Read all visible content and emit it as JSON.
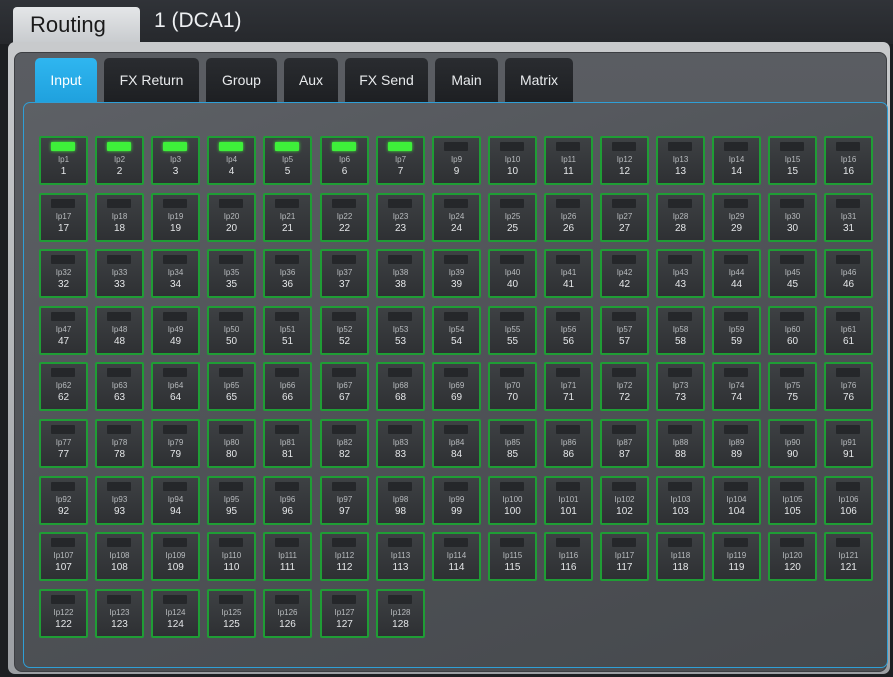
{
  "header": {
    "title": "Routing",
    "subtitle": "1 (DCA1)"
  },
  "tabs": [
    {
      "label": "Input",
      "active": true
    },
    {
      "label": "FX Return",
      "active": false
    },
    {
      "label": "Group",
      "active": false
    },
    {
      "label": "Aux",
      "active": false
    },
    {
      "label": "FX Send",
      "active": false
    },
    {
      "label": "Main",
      "active": false
    },
    {
      "label": "Matrix",
      "active": false
    }
  ],
  "colors": {
    "accent": "#2fb6f0",
    "led_on": "#3ef03a",
    "button_border": "#1f9d35"
  },
  "inputs": [
    {
      "name": "Ip1",
      "number": "1",
      "on": true
    },
    {
      "name": "Ip2",
      "number": "2",
      "on": true
    },
    {
      "name": "Ip3",
      "number": "3",
      "on": true
    },
    {
      "name": "Ip4",
      "number": "4",
      "on": true
    },
    {
      "name": "Ip5",
      "number": "5",
      "on": true
    },
    {
      "name": "Ip6",
      "number": "6",
      "on": true
    },
    {
      "name": "Ip7",
      "number": "7",
      "on": true
    },
    {
      "name": "Ip9",
      "number": "9",
      "on": false
    },
    {
      "name": "Ip10",
      "number": "10",
      "on": false
    },
    {
      "name": "Ip11",
      "number": "11",
      "on": false
    },
    {
      "name": "Ip12",
      "number": "12",
      "on": false
    },
    {
      "name": "Ip13",
      "number": "13",
      "on": false
    },
    {
      "name": "Ip14",
      "number": "14",
      "on": false
    },
    {
      "name": "Ip15",
      "number": "15",
      "on": false
    },
    {
      "name": "Ip16",
      "number": "16",
      "on": false
    },
    {
      "name": "Ip17",
      "number": "17",
      "on": false
    },
    {
      "name": "Ip18",
      "number": "18",
      "on": false
    },
    {
      "name": "Ip19",
      "number": "19",
      "on": false
    },
    {
      "name": "Ip20",
      "number": "20",
      "on": false
    },
    {
      "name": "Ip21",
      "number": "21",
      "on": false
    },
    {
      "name": "Ip22",
      "number": "22",
      "on": false
    },
    {
      "name": "Ip23",
      "number": "23",
      "on": false
    },
    {
      "name": "Ip24",
      "number": "24",
      "on": false
    },
    {
      "name": "Ip25",
      "number": "25",
      "on": false
    },
    {
      "name": "Ip26",
      "number": "26",
      "on": false
    },
    {
      "name": "Ip27",
      "number": "27",
      "on": false
    },
    {
      "name": "Ip28",
      "number": "28",
      "on": false
    },
    {
      "name": "Ip29",
      "number": "29",
      "on": false
    },
    {
      "name": "Ip30",
      "number": "30",
      "on": false
    },
    {
      "name": "Ip31",
      "number": "31",
      "on": false
    },
    {
      "name": "Ip32",
      "number": "32",
      "on": false
    },
    {
      "name": "Ip33",
      "number": "33",
      "on": false
    },
    {
      "name": "Ip34",
      "number": "34",
      "on": false
    },
    {
      "name": "Ip35",
      "number": "35",
      "on": false
    },
    {
      "name": "Ip36",
      "number": "36",
      "on": false
    },
    {
      "name": "Ip37",
      "number": "37",
      "on": false
    },
    {
      "name": "Ip38",
      "number": "38",
      "on": false
    },
    {
      "name": "Ip39",
      "number": "39",
      "on": false
    },
    {
      "name": "Ip40",
      "number": "40",
      "on": false
    },
    {
      "name": "Ip41",
      "number": "41",
      "on": false
    },
    {
      "name": "Ip42",
      "number": "42",
      "on": false
    },
    {
      "name": "Ip43",
      "number": "43",
      "on": false
    },
    {
      "name": "Ip44",
      "number": "44",
      "on": false
    },
    {
      "name": "Ip45",
      "number": "45",
      "on": false
    },
    {
      "name": "Ip46",
      "number": "46",
      "on": false
    },
    {
      "name": "Ip47",
      "number": "47",
      "on": false
    },
    {
      "name": "Ip48",
      "number": "48",
      "on": false
    },
    {
      "name": "Ip49",
      "number": "49",
      "on": false
    },
    {
      "name": "Ip50",
      "number": "50",
      "on": false
    },
    {
      "name": "Ip51",
      "number": "51",
      "on": false
    },
    {
      "name": "Ip52",
      "number": "52",
      "on": false
    },
    {
      "name": "Ip53",
      "number": "53",
      "on": false
    },
    {
      "name": "Ip54",
      "number": "54",
      "on": false
    },
    {
      "name": "Ip55",
      "number": "55",
      "on": false
    },
    {
      "name": "Ip56",
      "number": "56",
      "on": false
    },
    {
      "name": "Ip57",
      "number": "57",
      "on": false
    },
    {
      "name": "Ip58",
      "number": "58",
      "on": false
    },
    {
      "name": "Ip59",
      "number": "59",
      "on": false
    },
    {
      "name": "Ip60",
      "number": "60",
      "on": false
    },
    {
      "name": "Ip61",
      "number": "61",
      "on": false
    },
    {
      "name": "Ip62",
      "number": "62",
      "on": false
    },
    {
      "name": "Ip63",
      "number": "63",
      "on": false
    },
    {
      "name": "Ip64",
      "number": "64",
      "on": false
    },
    {
      "name": "Ip65",
      "number": "65",
      "on": false
    },
    {
      "name": "Ip66",
      "number": "66",
      "on": false
    },
    {
      "name": "Ip67",
      "number": "67",
      "on": false
    },
    {
      "name": "Ip68",
      "number": "68",
      "on": false
    },
    {
      "name": "Ip69",
      "number": "69",
      "on": false
    },
    {
      "name": "Ip70",
      "number": "70",
      "on": false
    },
    {
      "name": "Ip71",
      "number": "71",
      "on": false
    },
    {
      "name": "Ip72",
      "number": "72",
      "on": false
    },
    {
      "name": "Ip73",
      "number": "73",
      "on": false
    },
    {
      "name": "Ip74",
      "number": "74",
      "on": false
    },
    {
      "name": "Ip75",
      "number": "75",
      "on": false
    },
    {
      "name": "Ip76",
      "number": "76",
      "on": false
    },
    {
      "name": "Ip77",
      "number": "77",
      "on": false
    },
    {
      "name": "Ip78",
      "number": "78",
      "on": false
    },
    {
      "name": "Ip79",
      "number": "79",
      "on": false
    },
    {
      "name": "Ip80",
      "number": "80",
      "on": false
    },
    {
      "name": "Ip81",
      "number": "81",
      "on": false
    },
    {
      "name": "Ip82",
      "number": "82",
      "on": false
    },
    {
      "name": "Ip83",
      "number": "83",
      "on": false
    },
    {
      "name": "Ip84",
      "number": "84",
      "on": false
    },
    {
      "name": "Ip85",
      "number": "85",
      "on": false
    },
    {
      "name": "Ip86",
      "number": "86",
      "on": false
    },
    {
      "name": "Ip87",
      "number": "87",
      "on": false
    },
    {
      "name": "Ip88",
      "number": "88",
      "on": false
    },
    {
      "name": "Ip89",
      "number": "89",
      "on": false
    },
    {
      "name": "Ip90",
      "number": "90",
      "on": false
    },
    {
      "name": "Ip91",
      "number": "91",
      "on": false
    },
    {
      "name": "Ip92",
      "number": "92",
      "on": false
    },
    {
      "name": "Ip93",
      "number": "93",
      "on": false
    },
    {
      "name": "Ip94",
      "number": "94",
      "on": false
    },
    {
      "name": "Ip95",
      "number": "95",
      "on": false
    },
    {
      "name": "Ip96",
      "number": "96",
      "on": false
    },
    {
      "name": "Ip97",
      "number": "97",
      "on": false
    },
    {
      "name": "Ip98",
      "number": "98",
      "on": false
    },
    {
      "name": "Ip99",
      "number": "99",
      "on": false
    },
    {
      "name": "Ip100",
      "number": "100",
      "on": false
    },
    {
      "name": "Ip101",
      "number": "101",
      "on": false
    },
    {
      "name": "Ip102",
      "number": "102",
      "on": false
    },
    {
      "name": "Ip103",
      "number": "103",
      "on": false
    },
    {
      "name": "Ip104",
      "number": "104",
      "on": false
    },
    {
      "name": "Ip105",
      "number": "105",
      "on": false
    },
    {
      "name": "Ip106",
      "number": "106",
      "on": false
    },
    {
      "name": "Ip107",
      "number": "107",
      "on": false
    },
    {
      "name": "Ip108",
      "number": "108",
      "on": false
    },
    {
      "name": "Ip109",
      "number": "109",
      "on": false
    },
    {
      "name": "Ip110",
      "number": "110",
      "on": false
    },
    {
      "name": "Ip111",
      "number": "111",
      "on": false
    },
    {
      "name": "Ip112",
      "number": "112",
      "on": false
    },
    {
      "name": "Ip113",
      "number": "113",
      "on": false
    },
    {
      "name": "Ip114",
      "number": "114",
      "on": false
    },
    {
      "name": "Ip115",
      "number": "115",
      "on": false
    },
    {
      "name": "Ip116",
      "number": "116",
      "on": false
    },
    {
      "name": "Ip117",
      "number": "117",
      "on": false
    },
    {
      "name": "Ip118",
      "number": "118",
      "on": false
    },
    {
      "name": "Ip119",
      "number": "119",
      "on": false
    },
    {
      "name": "Ip120",
      "number": "120",
      "on": false
    },
    {
      "name": "Ip121",
      "number": "121",
      "on": false
    },
    {
      "name": "Ip122",
      "number": "122",
      "on": false
    },
    {
      "name": "Ip123",
      "number": "123",
      "on": false
    },
    {
      "name": "Ip124",
      "number": "124",
      "on": false
    },
    {
      "name": "Ip125",
      "number": "125",
      "on": false
    },
    {
      "name": "Ip126",
      "number": "126",
      "on": false
    },
    {
      "name": "Ip127",
      "number": "127",
      "on": false
    },
    {
      "name": "Ip128",
      "number": "128",
      "on": false
    }
  ]
}
